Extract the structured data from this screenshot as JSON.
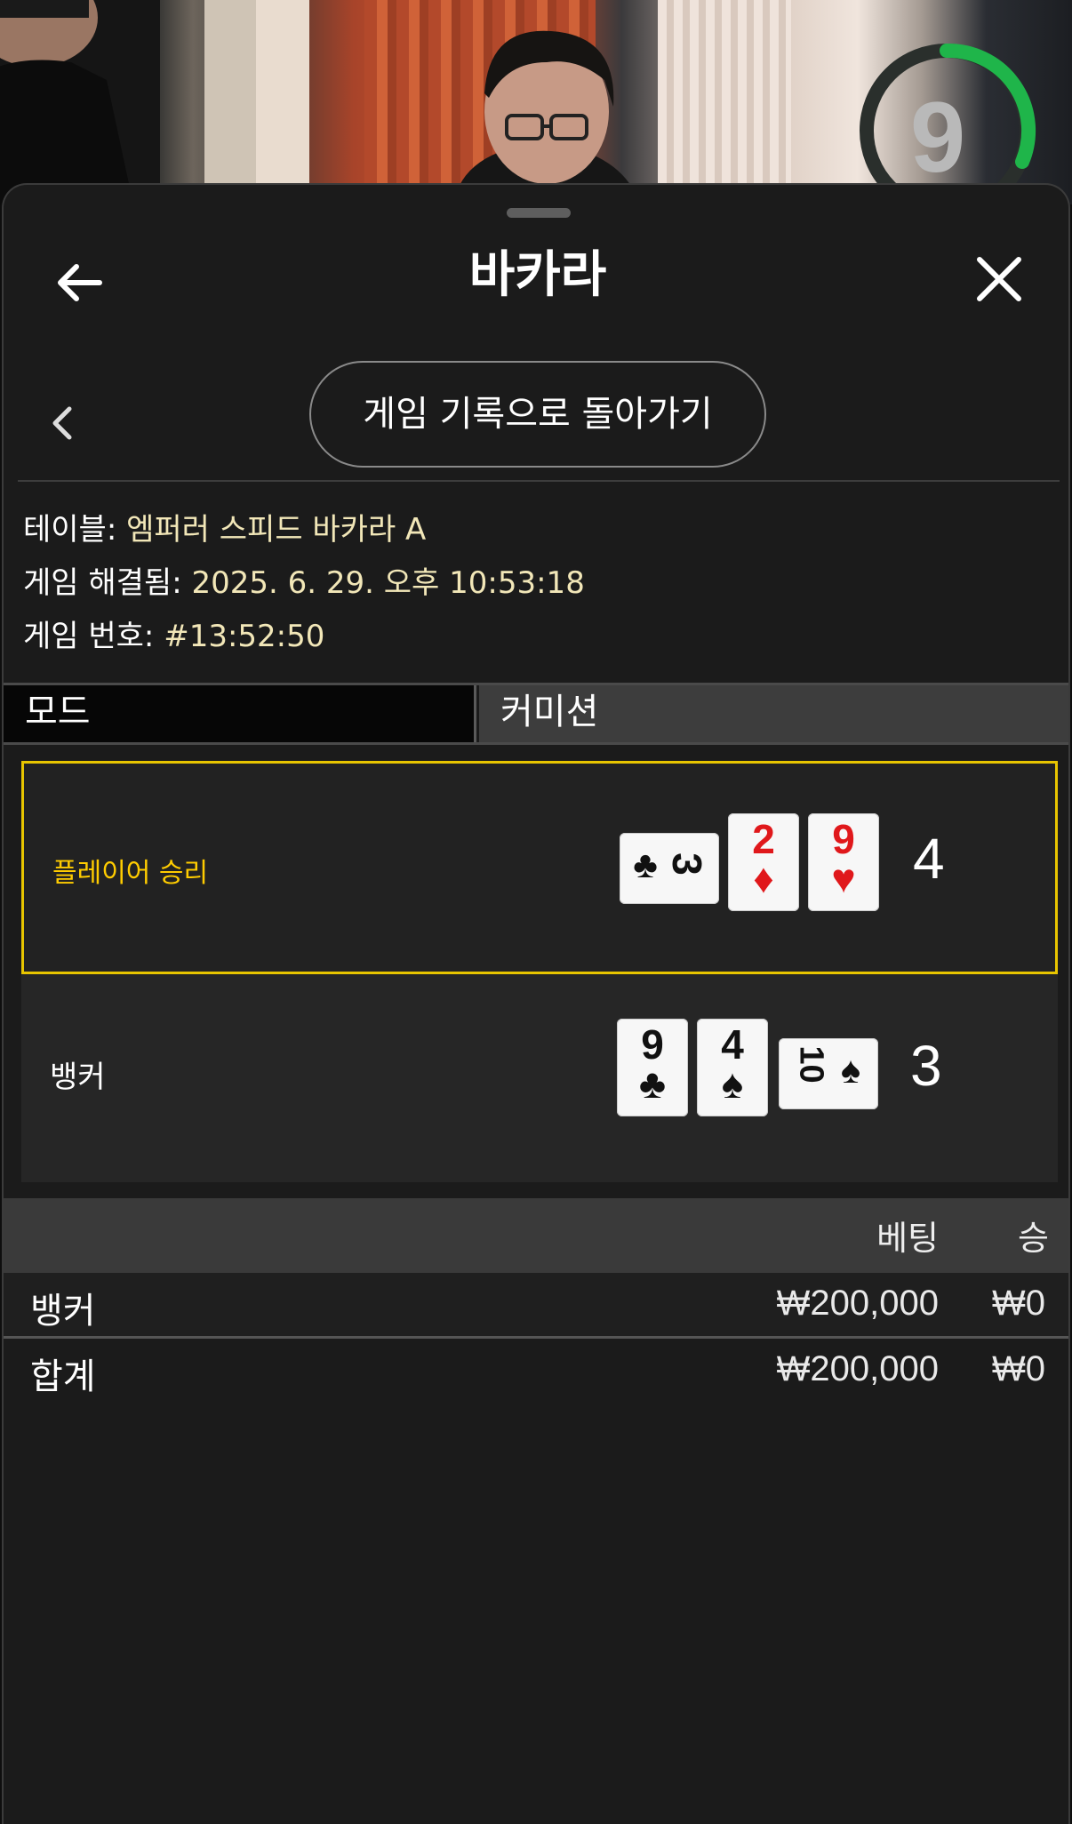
{
  "live": {
    "timer_value": "9",
    "timer_color": "#1fb54a"
  },
  "header": {
    "title": "바카라"
  },
  "history_button": {
    "label": "게임 기록으로 돌아가기"
  },
  "info": {
    "table_label": "테이블:",
    "table_value": "엠퍼러 스피드 바카라 A",
    "resolved_label": "게임 해결됨:",
    "resolved_value": "2025. 6. 29. 오후 10:53:18",
    "number_label": "게임 번호:",
    "number_value": "#13:52:50"
  },
  "tabs": {
    "mode": "모드",
    "commission": "커미션"
  },
  "result": {
    "player": {
      "label": "플레이어 승리",
      "score": "4",
      "cards": [
        {
          "rank": "3",
          "suit": "♣",
          "color": "#111111",
          "rotated": true
        },
        {
          "rank": "2",
          "suit": "♦",
          "color": "#e0181b",
          "rotated": false
        },
        {
          "rank": "9",
          "suit": "♥",
          "color": "#e0181b",
          "rotated": false
        }
      ]
    },
    "banker": {
      "label": "뱅커",
      "score": "3",
      "cards": [
        {
          "rank": "9",
          "suit": "♣",
          "color": "#111111",
          "rotated": false
        },
        {
          "rank": "4",
          "suit": "♠",
          "color": "#111111",
          "rotated": false
        },
        {
          "rank": "10",
          "suit": "♠",
          "color": "#111111",
          "rotated": true
        }
      ]
    },
    "highlight_color": "#e8c500"
  },
  "bets": {
    "col_bet": "베팅",
    "col_win": "승",
    "rows": [
      {
        "name": "뱅커",
        "bet": "₩200,000",
        "win": "₩0"
      }
    ],
    "total": {
      "name": "합계",
      "bet": "₩200,000",
      "win": "₩0"
    }
  }
}
